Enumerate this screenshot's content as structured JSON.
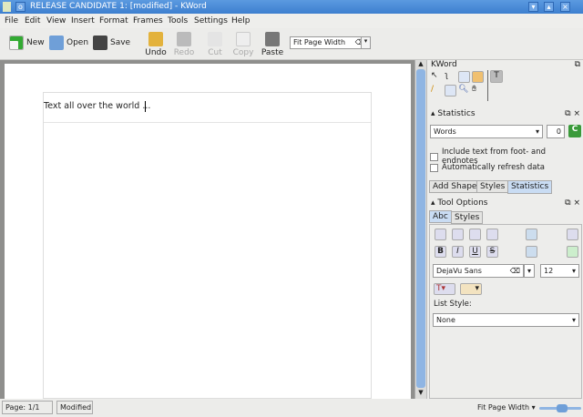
{
  "window": {
    "title": "RELEASE CANDIDATE 1: [modified] - KWord"
  },
  "menu": [
    "File",
    "Edit",
    "View",
    "Insert",
    "Format",
    "Frames",
    "Tools",
    "Settings",
    "Help"
  ],
  "toolbar": {
    "new": "New",
    "open": "Open",
    "save": "Save",
    "undo": "Undo",
    "redo": "Redo",
    "cut": "Cut",
    "copy": "Copy",
    "paste": "Paste",
    "zoom": "Fit Page Width"
  },
  "document": {
    "text": "Text all over the world ..."
  },
  "dock": {
    "kword_title": "KWord",
    "statistics": {
      "title": "Statistics",
      "mode": "Words",
      "count": "0",
      "include_foot": "Include text from foot- and endnotes",
      "auto_refresh": "Automatically refresh data"
    },
    "tabs": [
      "Add Shape",
      "Styles",
      "Statistics"
    ],
    "tool_options": {
      "title": "Tool Options",
      "tabs": [
        "Abc",
        "Styles"
      ],
      "font": "DejaVu Sans",
      "size": "12",
      "list_style_label": "List Style:",
      "list_style": "None"
    }
  },
  "status": {
    "page": "Page: 1/1",
    "modified": "Modified",
    "zoom": "Fit Page Width",
    "zoom_level": 0.55
  },
  "colors": {
    "titlebar": "#3d7fcf",
    "accent": "#c9dcf3"
  }
}
